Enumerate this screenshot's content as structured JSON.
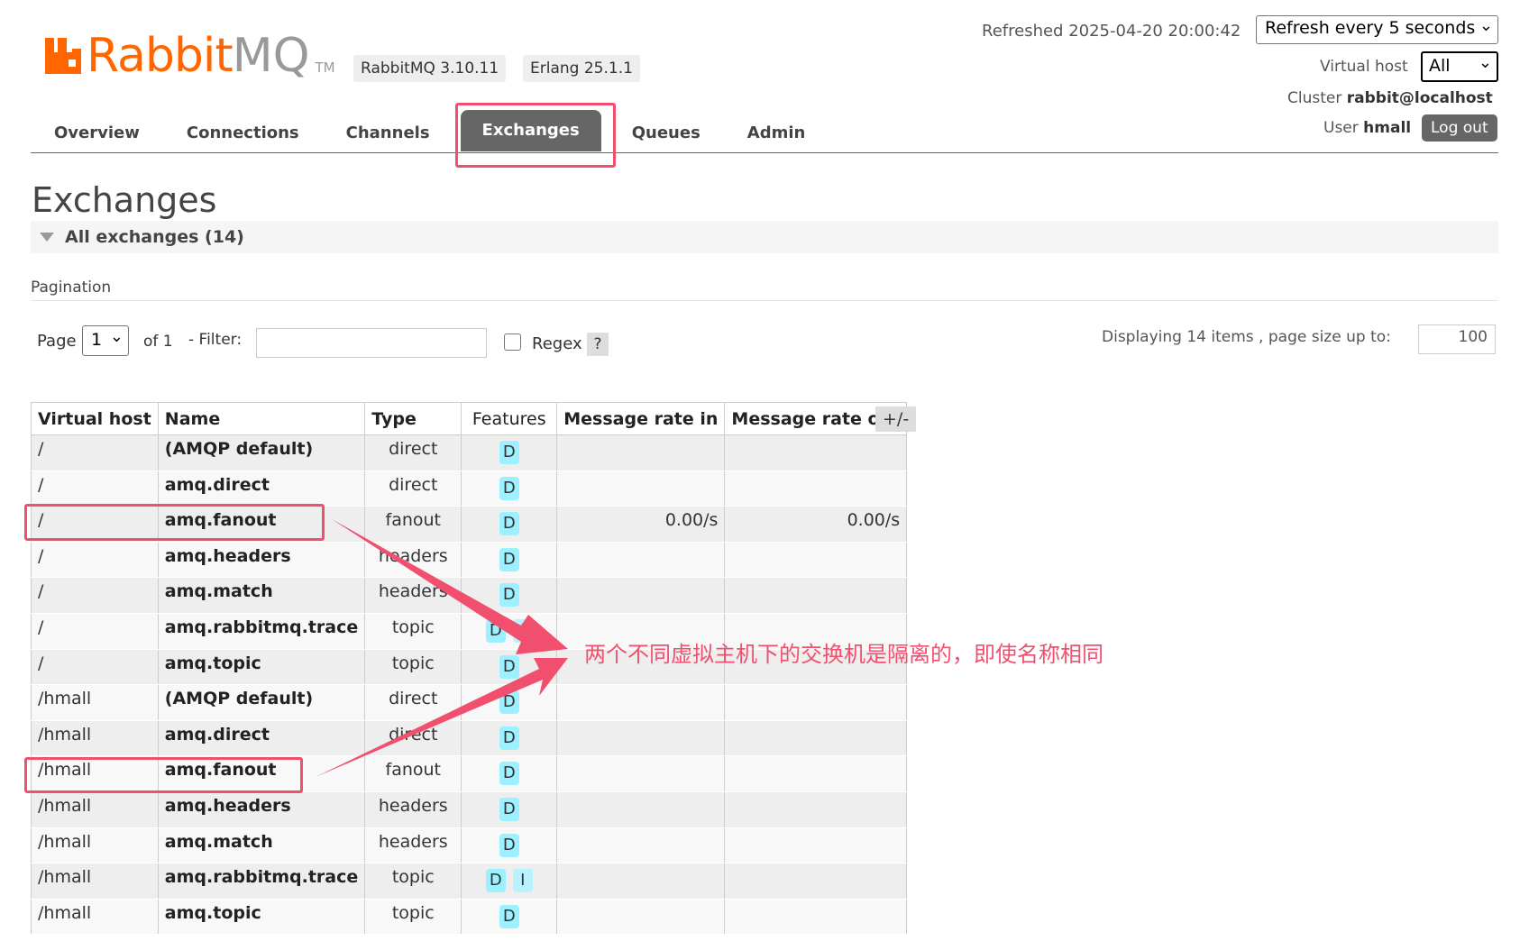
{
  "header": {
    "logo_rabbit": "Rabbit",
    "logo_mq": "MQ",
    "logo_tm": "TM",
    "version_badge": "RabbitMQ 3.10.11",
    "erlang_badge": "Erlang 25.1.1",
    "refreshed_label": "Refreshed 2025-04-20 20:00:42",
    "refresh_select": "Refresh every 5 seconds",
    "vhost_label": "Virtual host",
    "vhost_select": "All",
    "cluster_label": "Cluster",
    "cluster_value": "rabbit@localhost",
    "user_label": "User",
    "user_value": "hmall",
    "logout_label": "Log out"
  },
  "tabs": [
    {
      "label": "Overview"
    },
    {
      "label": "Connections"
    },
    {
      "label": "Channels"
    },
    {
      "label": "Exchanges",
      "active": true
    },
    {
      "label": "Queues"
    },
    {
      "label": "Admin"
    }
  ],
  "page": {
    "title": "Exchanges",
    "section_label": "All exchanges (14)",
    "pagination_label": "Pagination",
    "page_label": "Page",
    "page_select": "1",
    "of_label": "of 1",
    "filter_label": "- Filter:",
    "regex_label": "Regex",
    "help_label": "?",
    "displaying_label": "Displaying 14 items , page size up to:",
    "page_size": "100"
  },
  "table": {
    "columns": [
      "Virtual host",
      "Name",
      "Type",
      "Features",
      "Message rate in",
      "Message rate out"
    ],
    "plusminus": "+/-",
    "rows": [
      {
        "vhost": "/",
        "name": "(AMQP default)",
        "type": "direct",
        "features": [
          "D"
        ],
        "rate_in": "",
        "rate_out": ""
      },
      {
        "vhost": "/",
        "name": "amq.direct",
        "type": "direct",
        "features": [
          "D"
        ],
        "rate_in": "",
        "rate_out": ""
      },
      {
        "vhost": "/",
        "name": "amq.fanout",
        "type": "fanout",
        "features": [
          "D"
        ],
        "rate_in": "0.00/s",
        "rate_out": "0.00/s"
      },
      {
        "vhost": "/",
        "name": "amq.headers",
        "type": "headers",
        "features": [
          "D"
        ],
        "rate_in": "",
        "rate_out": ""
      },
      {
        "vhost": "/",
        "name": "amq.match",
        "type": "headers",
        "features": [
          "D"
        ],
        "rate_in": "",
        "rate_out": ""
      },
      {
        "vhost": "/",
        "name": "amq.rabbitmq.trace",
        "type": "topic",
        "features": [
          "D",
          "I"
        ],
        "rate_in": "",
        "rate_out": ""
      },
      {
        "vhost": "/",
        "name": "amq.topic",
        "type": "topic",
        "features": [
          "D"
        ],
        "rate_in": "",
        "rate_out": ""
      },
      {
        "vhost": "/hmall",
        "name": "(AMQP default)",
        "type": "direct",
        "features": [
          "D"
        ],
        "rate_in": "",
        "rate_out": ""
      },
      {
        "vhost": "/hmall",
        "name": "amq.direct",
        "type": "direct",
        "features": [
          "D"
        ],
        "rate_in": "",
        "rate_out": ""
      },
      {
        "vhost": "/hmall",
        "name": "amq.fanout",
        "type": "fanout",
        "features": [
          "D"
        ],
        "rate_in": "",
        "rate_out": ""
      },
      {
        "vhost": "/hmall",
        "name": "amq.headers",
        "type": "headers",
        "features": [
          "D"
        ],
        "rate_in": "",
        "rate_out": ""
      },
      {
        "vhost": "/hmall",
        "name": "amq.match",
        "type": "headers",
        "features": [
          "D"
        ],
        "rate_in": "",
        "rate_out": ""
      },
      {
        "vhost": "/hmall",
        "name": "amq.rabbitmq.trace",
        "type": "topic",
        "features": [
          "D",
          "I"
        ],
        "rate_in": "",
        "rate_out": ""
      },
      {
        "vhost": "/hmall",
        "name": "amq.topic",
        "type": "topic",
        "features": [
          "D"
        ],
        "rate_in": "",
        "rate_out": ""
      }
    ]
  },
  "annotation": {
    "text": "两个不同虚拟主机下的交换机是隔离的，即使名称相同",
    "color": "#f0506e"
  },
  "colors": {
    "brand_orange": "#ff6600",
    "tab_active_bg": "#666666",
    "feature_badge": "#9cf0ff"
  }
}
